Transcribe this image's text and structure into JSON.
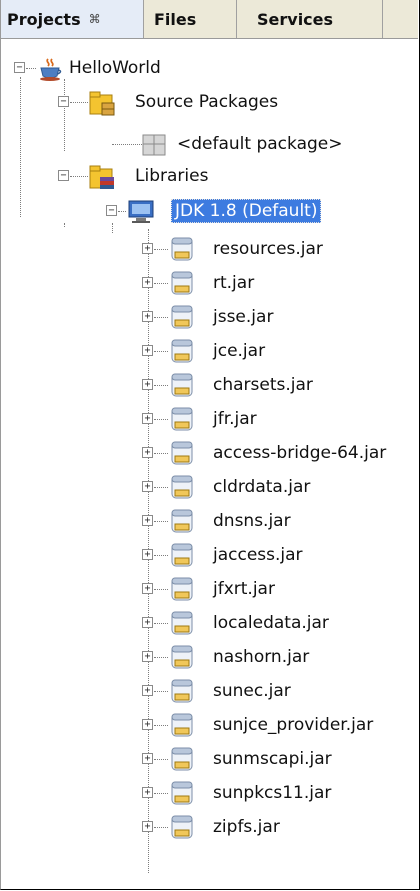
{
  "tabs": [
    {
      "label": "Projects",
      "active": true,
      "close_glyph": "⌘"
    },
    {
      "label": "Files"
    },
    {
      "label": "Services"
    }
  ],
  "tree": {
    "project": "HelloWorld",
    "source_packages": "Source Packages",
    "default_package": "<default package>",
    "libraries": "Libraries",
    "jdk": "JDK 1.8 (Default)",
    "jars": [
      "resources.jar",
      "rt.jar",
      "jsse.jar",
      "jce.jar",
      "charsets.jar",
      "jfr.jar",
      "access-bridge-64.jar",
      "cldrdata.jar",
      "dnsns.jar",
      "jaccess.jar",
      "jfxrt.jar",
      "localedata.jar",
      "nashorn.jar",
      "sunec.jar",
      "sunjce_provider.jar",
      "sunmscapi.jar",
      "sunpkcs11.jar",
      "zipfs.jar"
    ]
  },
  "colors": {
    "selection": "#3d7be0",
    "tab_bar": "#ece9d8",
    "active_tab": "#e5ecf7"
  },
  "icons": {
    "project": "java-coffee-cup-icon",
    "source_packages": "source-packages-folder-icon",
    "default_package": "package-icon",
    "libraries": "library-folder-icon",
    "jdk": "jdk-monitor-icon",
    "jar": "jar-file-icon"
  }
}
